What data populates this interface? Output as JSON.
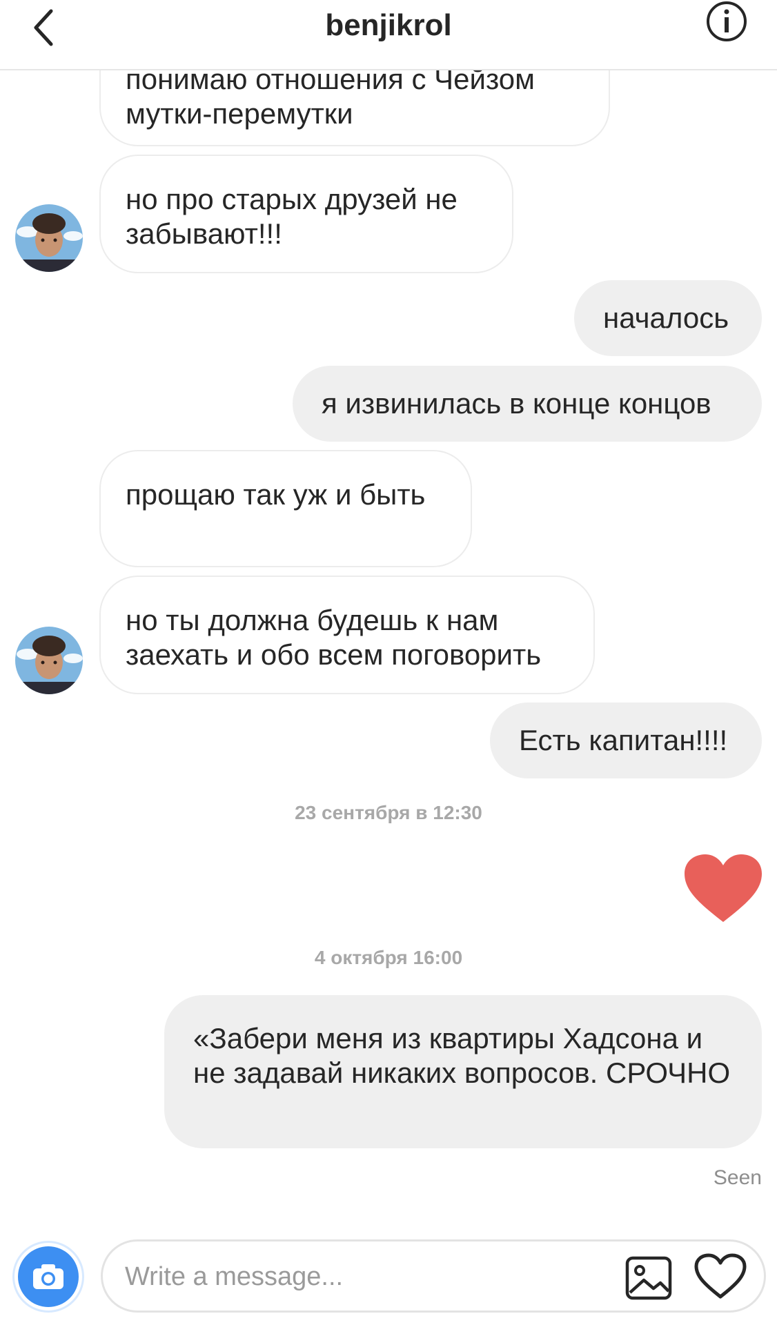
{
  "header": {
    "username": "benjikrol",
    "back_icon": "chevron-left-icon",
    "info_icon": "info-icon"
  },
  "messages": [
    {
      "side": "in",
      "text": "понимаю отношения с Чейзом мутки-перемутки"
    },
    {
      "side": "in",
      "text": "но про старых друзей не забывают!!!"
    },
    {
      "side": "out",
      "text": "началось"
    },
    {
      "side": "out",
      "text": "я извинилась в конце концов"
    },
    {
      "side": "in",
      "text": "прощаю так уж и быть"
    },
    {
      "side": "in",
      "text": "но ты должна будешь к нам заехать и обо всем поговорить"
    },
    {
      "side": "out",
      "text": "Есть капитан!!!!"
    },
    {
      "side": "out",
      "type": "heart",
      "icon": "heart-icon",
      "color": "#ed4956"
    },
    {
      "side": "out",
      "text": "«Забери меня из квартиры Хадсона и не задавай никаких вопросов. СРОЧНО"
    }
  ],
  "timestamps": [
    "23 сентября в 12:30",
    "4 октября 16:00"
  ],
  "seen_label": "Seen",
  "composer": {
    "placeholder": "Write a message...",
    "camera_icon": "camera-icon",
    "gallery_icon": "image-icon",
    "like_icon": "heart-outline-icon"
  },
  "colors": {
    "accent_blue": "#3d8ff2",
    "heart_red": "#ed4956",
    "outgoing_bubble": "#efefef"
  }
}
